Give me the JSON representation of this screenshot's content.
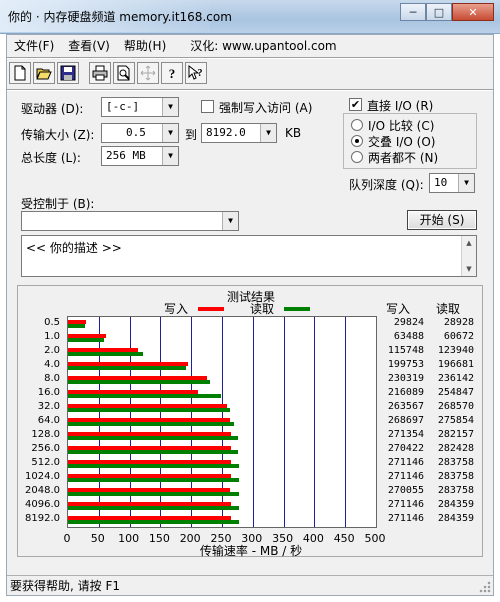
{
  "window": {
    "title": "你的 · 内存硬盘频道 memory.it168.com",
    "minimize": "─",
    "maximize": "□",
    "close": "✕"
  },
  "menu": {
    "file": "文件(F)",
    "view": "查看(V)",
    "help": "帮助(H)",
    "localized": "汉化: www.upantool.com"
  },
  "toolbar": [
    "new-icon",
    "open-icon",
    "save-icon",
    "print-icon",
    "print-preview-icon",
    "move-icon",
    "help-icon",
    "context-help-icon"
  ],
  "form": {
    "drive_label": "驱动器 (D):",
    "drive_value": "[-c-]",
    "force_write_label": "强制写入访问 (A)",
    "direct_io_label": "直接 I/O (R)",
    "direct_io_checked": true,
    "transfer_size_label": "传输大小 (Z):",
    "transfer_from": "0.5",
    "to_label": "到",
    "transfer_to": "8192.0",
    "kb_label": "KB",
    "total_length_label": "总长度 (L):",
    "total_length_value": "256 MB",
    "io_compare_label": "I/O 比较 (C)",
    "overlap_io_label": "交叠 I/O (O)",
    "neither_label": "两者都不 (N)",
    "queue_depth_label": "队列深度 (Q):",
    "queue_depth_value": "10",
    "controlled_by_label": "受控制于 (B):",
    "controlled_by_value": "",
    "start_button": "开始 (S)",
    "description": "<<   你的描述   >>"
  },
  "results": {
    "title": "测试结果",
    "write_legend": "写入",
    "read_legend": "读取",
    "write_col": "写入",
    "read_col": "读取"
  },
  "chart_data": {
    "type": "bar",
    "orientation": "horizontal",
    "title": "测试结果",
    "xlabel": "传输速率 - MB / 秒",
    "xlim": [
      0,
      500
    ],
    "xticks": [
      "0",
      "50",
      "100",
      "150",
      "200",
      "250",
      "300",
      "350",
      "400",
      "450",
      "500"
    ],
    "colors": {
      "write": "#ff0000",
      "read": "#008000"
    },
    "categories": [
      "0.5",
      "1.0",
      "2.0",
      "4.0",
      "8.0",
      "16.0",
      "32.0",
      "64.0",
      "128.0",
      "256.0",
      "512.0",
      "1024.0",
      "2048.0",
      "4096.0",
      "8192.0"
    ],
    "series": [
      {
        "name": "写入",
        "values_kb": [
          29824,
          63488,
          115748,
          199753,
          230319,
          216089,
          263567,
          268697,
          271354,
          270422,
          271146,
          271146,
          270055,
          271146,
          271146
        ]
      },
      {
        "name": "读取",
        "values_kb": [
          28928,
          60672,
          123940,
          196681,
          236142,
          254847,
          268570,
          275854,
          282157,
          282428,
          283758,
          283758,
          283758,
          284359,
          284359
        ]
      }
    ]
  },
  "status": {
    "text": "要获得帮助, 请按 F1"
  }
}
